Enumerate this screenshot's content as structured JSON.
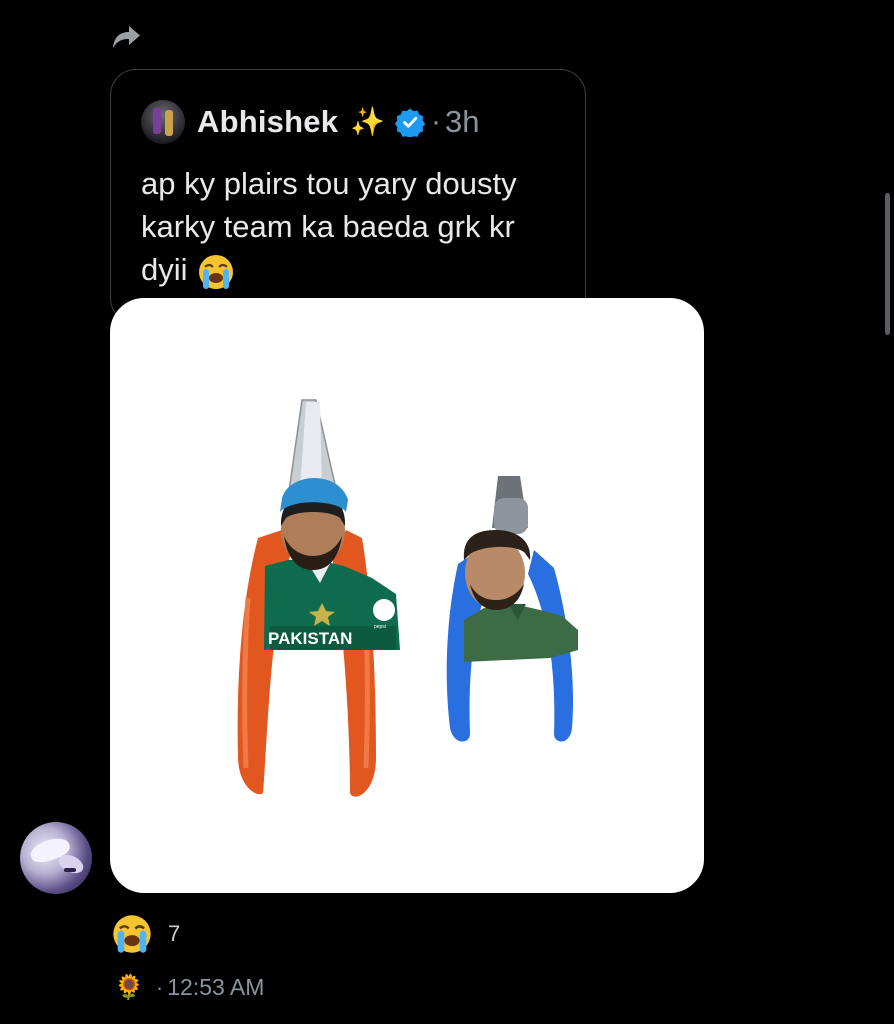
{
  "quote": {
    "author": "Abhishek",
    "sparkle_emoji": "✨",
    "separator": "·",
    "time": "3h",
    "text": "ap ky plairs tou yary dousty karky team ka baeda grk kr dyii",
    "trailing_emoji": "crying-face"
  },
  "media": {
    "image_text_jersey": "PAKISTAN",
    "image_text_sponsor": "pepsi"
  },
  "reaction": {
    "emoji": "crying-face",
    "count": "7"
  },
  "meta": {
    "emoji": "🌻",
    "separator": "·",
    "time": "12:53 AM"
  },
  "colors": {
    "background": "#000000",
    "text": "#e7e9ea",
    "muted": "#8b949e",
    "verified": "#1d9bf0",
    "card_border": "#3a3f45"
  }
}
